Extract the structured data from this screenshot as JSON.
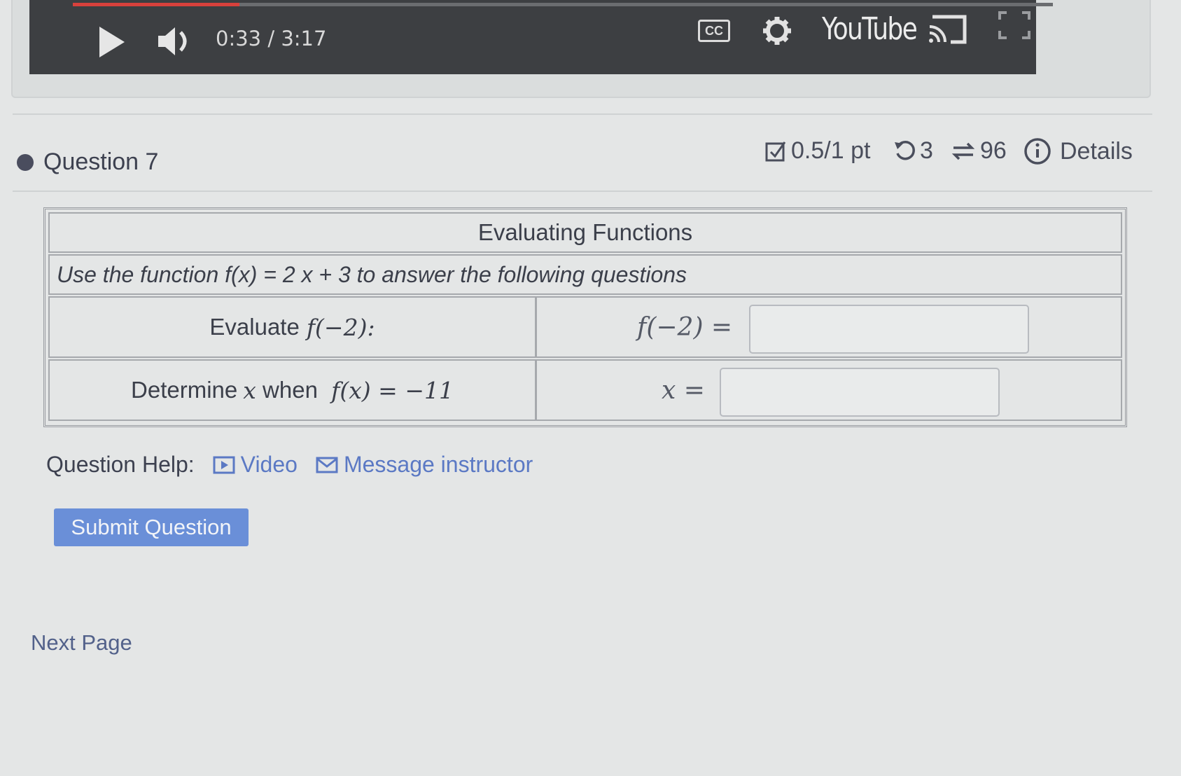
{
  "video": {
    "time": "0:33 / 3:17",
    "progress_fraction": 0.17,
    "cc_label": "CC",
    "brand": "YouTube",
    "icons": [
      "play-icon",
      "volume-icon",
      "cc-icon",
      "gear-icon",
      "cast-icon",
      "fullscreen-icon"
    ]
  },
  "question": {
    "title": "Question 7",
    "score": "0.5/1 pt",
    "retries": "3",
    "attempts": "96",
    "details_label": "Details"
  },
  "table": {
    "heading": "Evaluating Functions",
    "instruction": "Use the function f(x) = 2 x + 3 to answer the following questions",
    "rows": [
      {
        "prompt_prefix": "Evaluate ",
        "prompt_math": "f(−2):",
        "answer_label": "f(−2) =",
        "answer_value": ""
      },
      {
        "prompt_prefix": "Determine ",
        "prompt_var": "x",
        "prompt_mid": " when ",
        "prompt_math": "f(x) = −11",
        "answer_label": "x =",
        "answer_value": ""
      }
    ]
  },
  "help": {
    "label": "Question Help:",
    "video_label": "Video",
    "message_label": "Message instructor"
  },
  "submit_label": "Submit Question",
  "next_page_label": "Next Page",
  "colors": {
    "accent": "#6a8fd8",
    "link": "#5b79c4",
    "progress": "#d8413c"
  }
}
